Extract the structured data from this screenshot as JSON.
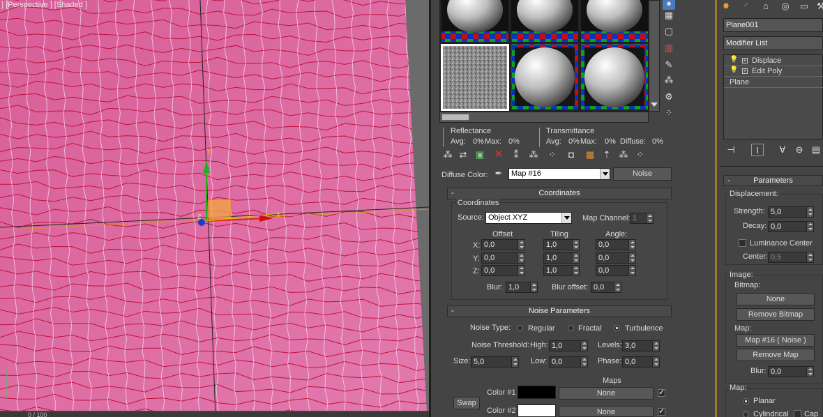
{
  "viewport": {
    "label": "] [Perspective ] [Shaded ]",
    "frame_counter": "0 / 100",
    "gizmo_x": "X",
    "gizmo_y": "Y",
    "gizmo_z": "Z"
  },
  "material_editor": {
    "reflectance": {
      "title": "Reflectance",
      "avg_label": "Avg:",
      "avg": "0%",
      "max_label": "Max:",
      "max": "0%"
    },
    "transmittance": {
      "title": "Transmittance",
      "avg_label": "Avg:",
      "avg": "0%",
      "max_label": "Max:",
      "max": "0%",
      "diffuse_label": "Diffuse:",
      "diffuse": "0%"
    },
    "diffuse_color_label": "Diffuse Color:",
    "map_name": "Map #16",
    "map_type": "Noise",
    "coordinates": {
      "rollout_title": "Coordinates",
      "group_title": "Coordinates",
      "source_label": "Source:",
      "source_value": "Object XYZ",
      "map_channel_label": "Map Channel:",
      "map_channel_value": "1",
      "offset_header": "Offset",
      "tiling_header": "Tiling",
      "angle_header": "Angle:",
      "rows": [
        {
          "axis": "X:",
          "offset": "0,0",
          "tiling": "1,0",
          "angle": "0,0"
        },
        {
          "axis": "Y:",
          "offset": "0,0",
          "tiling": "1,0",
          "angle": "0,0"
        },
        {
          "axis": "Z:",
          "offset": "0,0",
          "tiling": "1,0",
          "angle": "0,0"
        }
      ],
      "blur_label": "Blur:",
      "blur_value": "1,0",
      "blur_offset_label": "Blur offset:",
      "blur_offset_value": "0,0"
    },
    "noise": {
      "rollout_title": "Noise Parameters",
      "type_label": "Noise Type:",
      "type_options": [
        "Regular",
        "Fractal",
        "Turbulence"
      ],
      "selected_type": "Turbulence",
      "threshold_label": "Noise Threshold:",
      "high_label": "High:",
      "high_value": "1,0",
      "levels_label": "Levels:",
      "levels_value": "3,0",
      "size_label": "Size:",
      "size_value": "5,0",
      "low_label": "Low:",
      "low_value": "0,0",
      "phase_label": "Phase:",
      "phase_value": "0,0",
      "maps_header": "Maps",
      "swap_label": "Swap",
      "color1_label": "Color #1",
      "color1_hex": "#000000",
      "color1_map": "None",
      "color2_label": "Color #2",
      "color2_hex": "#ffffff",
      "color2_map": "None"
    }
  },
  "command_panel": {
    "object_name": "Plane001",
    "modifier_list_label": "Modifier List",
    "stack": [
      "Displace",
      "Edit Poly",
      "Plane"
    ],
    "parameters_title": "Parameters",
    "displacement_label": "Displacement:",
    "strength_label": "Strength:",
    "strength_value": "5,0",
    "decay_label": "Decay:",
    "decay_value": "0,0",
    "luminance_center_label": "Luminance Center",
    "center_label": "Center:",
    "center_value": "0,5",
    "image_label": "Image:",
    "bitmap_label": "Bitmap:",
    "bitmap_button": "None",
    "remove_bitmap": "Remove Bitmap",
    "map_label": "Map:",
    "map_button": "Map #16  ( Noise )",
    "remove_map": "Remove Map",
    "blur_label": "Blur:",
    "blur_value": "0,0",
    "map_group_label": "Map:",
    "planar_label": "Planar",
    "cylindrical_label": "Cylindrical",
    "cap_label": "Cap"
  },
  "colors": {
    "mesh_fill": "#d9669c",
    "mesh_edge": "#c0103a",
    "ui_bg": "#444444",
    "accent_frame": "#9a7b2a"
  }
}
